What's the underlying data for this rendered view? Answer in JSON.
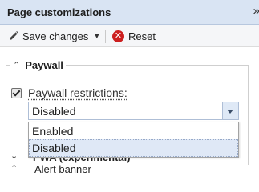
{
  "panel": {
    "title": "Page customizations",
    "collapse_glyph": "»"
  },
  "toolbar": {
    "save_label": "Save changes",
    "save_icon": "pencil-icon",
    "reset_label": "Reset",
    "reset_icon": "remove-icon"
  },
  "paywall": {
    "legend": "Paywall",
    "checkbox_label": "Paywall restrictions:",
    "checked": true,
    "selected": "Disabled",
    "options": [
      "Enabled",
      "Disabled"
    ]
  },
  "behind": {
    "section_title": "PWA (experimental)",
    "next_label": "Alert banner"
  },
  "colors": {
    "titlebar": "#d9e4f3",
    "accent": "#aebed6",
    "reset": "#cc1f1f",
    "selected_option": "#dfe8f6"
  }
}
